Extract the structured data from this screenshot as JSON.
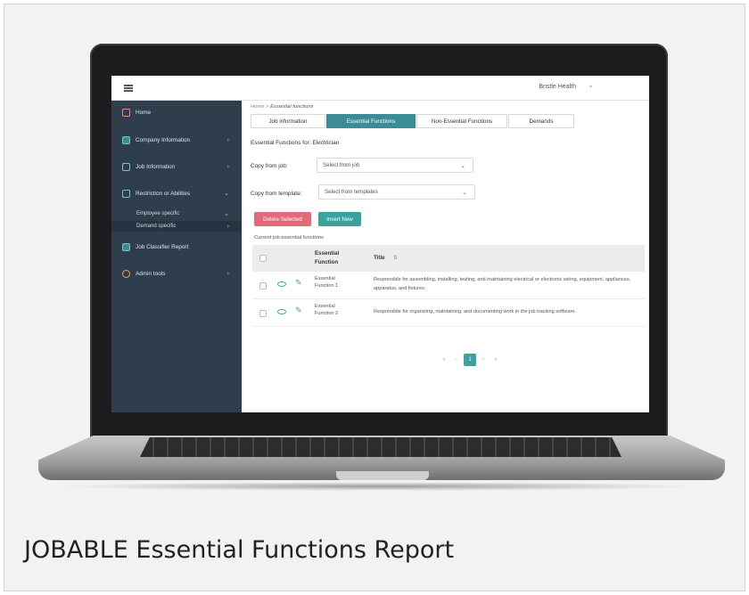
{
  "caption": "JOBABLE Essential Functions Report",
  "app": {
    "account_name": "Bristle Health",
    "account_chevron": "chevron-down-icon",
    "sidebar": {
      "items": [
        {
          "label": "Home",
          "icon": "home-icon"
        },
        {
          "label": "Company Information",
          "icon": "building-icon"
        },
        {
          "label": "Job Information",
          "icon": "briefcase-icon"
        },
        {
          "label": "Restriction or Abilities",
          "icon": "restriction-icon"
        },
        {
          "label": "Job Classifier Report",
          "icon": "report-icon"
        },
        {
          "label": "Admin tools",
          "icon": "gear-icon"
        }
      ],
      "subitems": [
        {
          "label": "Employee specific"
        },
        {
          "label": "Demand specific"
        }
      ]
    },
    "breadcrumb": {
      "home": "Home",
      "separator": ">",
      "current": "Essential functions"
    },
    "tabs": [
      {
        "label": "Job information"
      },
      {
        "label": "Essential Functions"
      },
      {
        "label": "Non-Essential Functions"
      },
      {
        "label": "Demands"
      }
    ],
    "section_title": "Essential Functions for: Electrician",
    "copy_from_job": {
      "label": "Copy from job:",
      "value": "Select from job"
    },
    "copy_from_template": {
      "label": "Copy from template:",
      "value": "Select from templates"
    },
    "buttons": {
      "delete": "Delete Selected",
      "insert": "Insert New"
    },
    "list_caption": "Current job essential functions",
    "table": {
      "headers": {
        "function": "Essential Function",
        "title": "Title",
        "sort_icon": "sort-icon"
      },
      "rows": [
        {
          "function": "Essential Function 1",
          "description": "Responsible for assembling, installing, testing, and maintaining electrical or electronic wiring, equipment, appliances, apparatus, and fixtures."
        },
        {
          "function": "Essential Function 2",
          "description": "Responsible for organizing, maintaining, and documenting work in the job tracking software."
        }
      ]
    },
    "pagination": {
      "first": "«",
      "prev": "‹",
      "current": "1",
      "next": "›",
      "last": "»"
    }
  }
}
